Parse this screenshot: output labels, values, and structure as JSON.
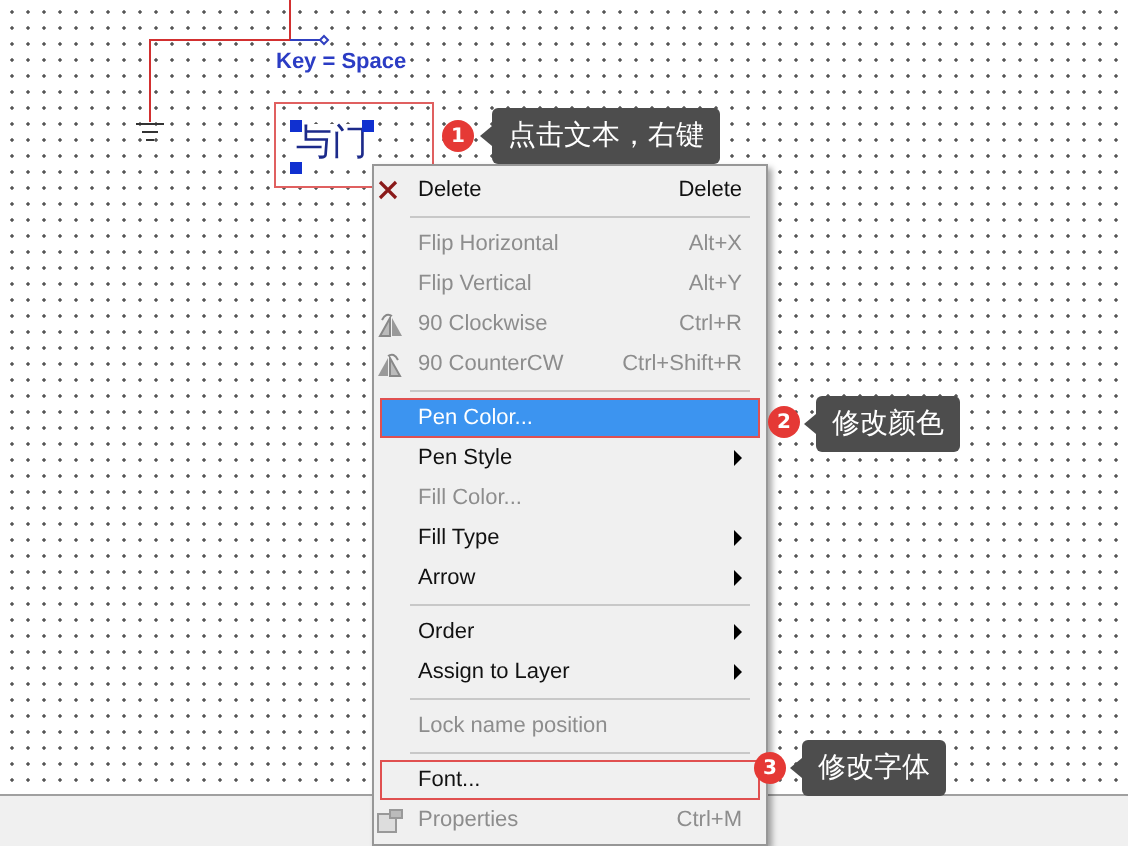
{
  "canvas": {
    "key_label": "Key = Space",
    "selected_text": "与门",
    "text_highlighted": true
  },
  "menu": {
    "items": [
      {
        "kind": "delete",
        "label": "Delete",
        "shortcut": "Delete",
        "disabled": false,
        "selected": false,
        "highlighted": false
      },
      {
        "kind": "separator"
      },
      {
        "kind": "plain",
        "label": "Flip Horizontal",
        "shortcut": "Alt+X",
        "disabled": true,
        "selected": false,
        "highlighted": false
      },
      {
        "kind": "plain",
        "label": "Flip Vertical",
        "shortcut": "Alt+Y",
        "disabled": true,
        "selected": false,
        "highlighted": false
      },
      {
        "kind": "rotate-cw",
        "label": "90 Clockwise",
        "shortcut": "Ctrl+R",
        "disabled": true,
        "selected": false,
        "highlighted": false
      },
      {
        "kind": "rotate-ccw",
        "label": "90 CounterCW",
        "shortcut": "Ctrl+Shift+R",
        "disabled": true,
        "selected": false,
        "highlighted": false
      },
      {
        "kind": "separator"
      },
      {
        "kind": "plain",
        "label": "Pen Color...",
        "disabled": false,
        "selected": true,
        "highlighted": true
      },
      {
        "kind": "submenu",
        "label": "Pen Style",
        "disabled": false,
        "selected": false,
        "highlighted": false
      },
      {
        "kind": "plain",
        "label": "Fill Color...",
        "disabled": true,
        "selected": false,
        "highlighted": false
      },
      {
        "kind": "submenu",
        "label": "Fill Type",
        "disabled": false,
        "selected": false,
        "highlighted": false
      },
      {
        "kind": "submenu",
        "label": "Arrow",
        "disabled": false,
        "selected": false,
        "highlighted": false
      },
      {
        "kind": "separator"
      },
      {
        "kind": "submenu",
        "label": "Order",
        "disabled": false,
        "selected": false,
        "highlighted": false
      },
      {
        "kind": "submenu",
        "label": "Assign to Layer",
        "disabled": false,
        "selected": false,
        "highlighted": false
      },
      {
        "kind": "separator"
      },
      {
        "kind": "plain",
        "label": "Lock name position",
        "disabled": true,
        "selected": false,
        "highlighted": false
      },
      {
        "kind": "separator"
      },
      {
        "kind": "plain",
        "label": "Font...",
        "disabled": false,
        "selected": false,
        "highlighted": true
      },
      {
        "kind": "properties",
        "label": "Properties",
        "shortcut": "Ctrl+M",
        "disabled": true,
        "selected": false,
        "highlighted": false
      }
    ]
  },
  "callouts": [
    {
      "number": "1",
      "text": "点击文本，右键"
    },
    {
      "number": "2",
      "text": "修改颜色"
    },
    {
      "number": "3",
      "text": "修改字体"
    }
  ]
}
